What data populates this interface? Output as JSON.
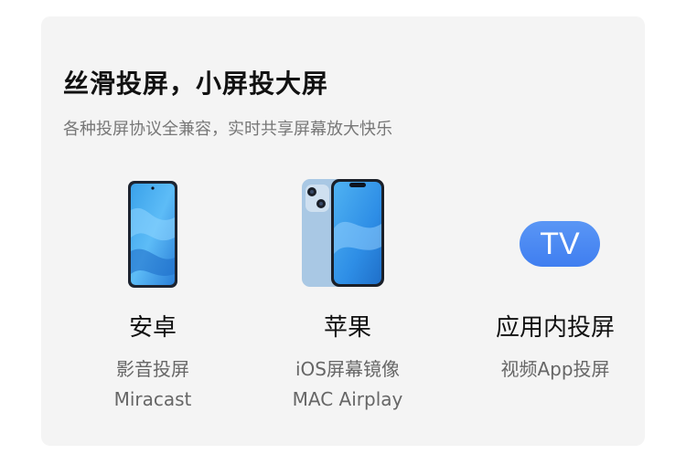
{
  "header": {
    "title": "丝滑投屏，小屏投大屏",
    "subtitle": "各种投屏协议全兼容，实时共享屏幕放大快乐"
  },
  "columns": [
    {
      "name": "安卓",
      "desc_line1": "影音投屏",
      "desc_line2": "Miracast",
      "icon": "android-phone-icon"
    },
    {
      "name": "苹果",
      "desc_line1": "iOS屏幕镜像",
      "desc_line2": "MAC Airplay",
      "icon": "iphone-icon"
    },
    {
      "name": "应用内投屏",
      "desc_line1": "视频App投屏",
      "desc_line2": "",
      "icon": "tv-badge-icon",
      "badge_text": "TV"
    }
  ],
  "colors": {
    "card_bg": "#f4f4f4",
    "accent_blue": "#4a88f2",
    "title": "#111111",
    "subtext": "#666666"
  }
}
